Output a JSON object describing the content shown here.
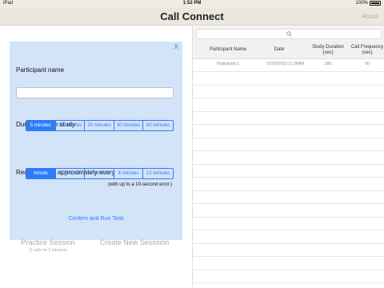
{
  "status_bar": {
    "device": "iPad",
    "time": "1:52 PM",
    "battery": "100%"
  },
  "nav": {
    "title": "Call Connect",
    "about": "About"
  },
  "dialog": {
    "close": "X",
    "participant_label": "Participant name",
    "participant_value": "",
    "duration_label": "Duration of the study",
    "duration_options": [
      "5 minutes",
      "10 minutes",
      "20 minutes",
      "30 minutes",
      "60 minutes"
    ],
    "duration_selected": "5 minutes",
    "call_label": "Receive a call approximately every",
    "call_options": [
      "minute",
      "2 minutes",
      "4 minutes",
      "6 minutes",
      "12 minutes"
    ],
    "call_selected": "minute",
    "call_note": "(with up to a 10-second error.)",
    "confirm": "Confirm and Run Task"
  },
  "actions": {
    "practice": "Practice Session",
    "practice_sub": "(2 calls for 2 minutes)",
    "create": "Create New Sesssion"
  },
  "table": {
    "headers": [
      "Participant Name",
      "Date",
      "Study Duration (sec)",
      "Call Frequency (sec)"
    ],
    "rows": [
      [
        "Participant 1",
        "07/20/2015 11:36AM",
        "300",
        "60"
      ]
    ]
  }
}
